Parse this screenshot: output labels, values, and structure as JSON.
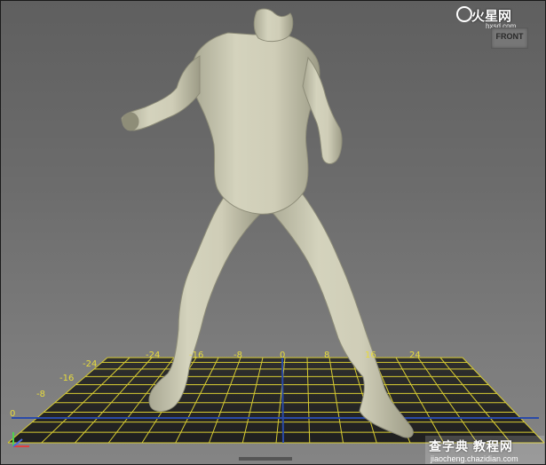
{
  "viewport": {
    "camera_label": "FRONT",
    "background_colors": [
      "#5f5f5f",
      "#848484"
    ],
    "grid_color": "#e8dc3c",
    "grid_axis_color": "#2a4aa8"
  },
  "model": {
    "kind": "headless humanoid bodysuit mesh",
    "color": "#c9c8b2"
  },
  "grid": {
    "x_labels": [
      "-24",
      "-16",
      "-8",
      "0",
      "8",
      "16",
      "24"
    ],
    "z_labels": [
      "-24",
      "-16",
      "-8",
      "0"
    ]
  },
  "watermarks": {
    "top_brand": "火星网",
    "top_url": "hxsd.com",
    "bottom_brand": "查字典 教程网",
    "bottom_url": "jiaocheng.chazidian.com"
  },
  "axis_icon": "xyz-axis-icon"
}
